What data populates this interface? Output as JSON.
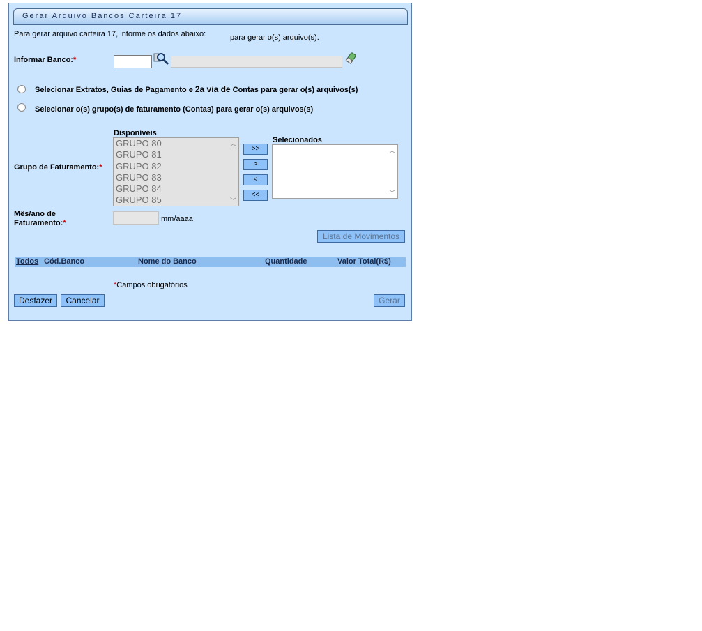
{
  "window": {
    "title": "Gerar Arquivo Bancos Carteira 17"
  },
  "intro": {
    "text": "Para gerar arquivo carteira 17, informe os dados abaixo:",
    "suffix": "para gerar o(s) arquivo(s)."
  },
  "banco": {
    "label": "Informar Banco:",
    "required_mark": "*",
    "code_value": "",
    "name_value": "",
    "search_icon": "magnifier-icon",
    "clear_icon": "eraser-icon"
  },
  "options": [
    {
      "label_part1": "Selecionar Extratos, Guias de Pagamento e",
      "label_part2": "2a via de",
      "label_part3": "Contas para gerar o(s) arquivos(s)",
      "checked": false
    },
    {
      "label": "Selecionar o(s) grupo(s) de faturamento (Contas) para gerar o(s) arquivos(s)",
      "checked": false
    }
  ],
  "grupo": {
    "label": "Grupo de Faturamento:",
    "required_mark": "*",
    "available_title": "Disponíveis",
    "selected_title": "Selecionados",
    "available": [
      "GRUPO 80",
      "GRUPO 81",
      "GRUPO 82",
      "GRUPO 83",
      "GRUPO 84",
      "GRUPO 85"
    ],
    "selected": [],
    "buttons": {
      "add_all": ">>",
      "add": ">",
      "remove": "<",
      "remove_all": "<<"
    }
  },
  "mes_ano": {
    "label_line1": "Mês/ano de",
    "label_line2": "Faturamento:",
    "required_mark": "*",
    "value": "",
    "hint": "mm/aaaa"
  },
  "actions": {
    "lista_movimentos": "Lista de Movimentos",
    "desfazer": "Desfazer",
    "cancelar": "Cancelar",
    "gerar": "Gerar"
  },
  "table": {
    "columns": [
      "Todos",
      "Cód.Banco",
      "Nome do Banco",
      "Quantidade",
      "Valor Total(R$)"
    ],
    "rows": []
  },
  "footer": {
    "required_mark": "*",
    "required_note": "Campos obrigatórios"
  },
  "colors": {
    "panel_bg": "#cbe5fe",
    "button_bg": "#8ec1f7",
    "header_bg": "#8ebef0",
    "required": "#cc0000"
  }
}
